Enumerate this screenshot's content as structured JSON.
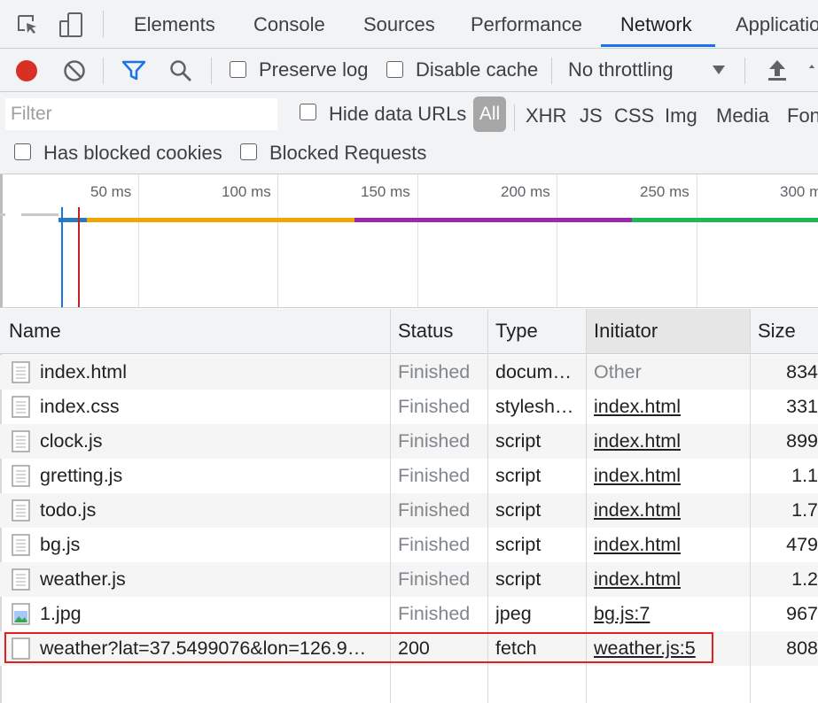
{
  "tabs": [
    {
      "label": "Elements"
    },
    {
      "label": "Console"
    },
    {
      "label": "Sources"
    },
    {
      "label": "Performance"
    },
    {
      "label": "Network",
      "active": true
    },
    {
      "label": "Applicatio"
    }
  ],
  "toolbar": {
    "preserve_log": "Preserve log",
    "disable_cache": "Disable cache",
    "throttling": "No throttling",
    "record_color": "#d93025"
  },
  "filter": {
    "placeholder": "Filter",
    "hide_data_urls": "Hide data URLs",
    "types": [
      "All",
      "XHR",
      "JS",
      "CSS",
      "Img",
      "Media",
      "Fon"
    ],
    "has_blocked_cookies": "Has blocked cookies",
    "blocked_requests": "Blocked Requests"
  },
  "overview": {
    "ticks": [
      "50 ms",
      "100 ms",
      "150 ms",
      "200 ms",
      "250 ms",
      "300 m"
    ],
    "phase_colors": [
      "#f0a500",
      "#9c27b0",
      "#1db954"
    ],
    "dcl_color": "#1a73e8",
    "load_color": "#c5221f"
  },
  "table": {
    "columns": {
      "name": "Name",
      "status": "Status",
      "type": "Type",
      "initiator": "Initiator",
      "size": "Size"
    },
    "rows": [
      {
        "name": "index.html",
        "status": "Finished",
        "type": "docum…",
        "initiator": "Other",
        "size": "834",
        "icon": "document-icon"
      },
      {
        "name": "index.css",
        "status": "Finished",
        "type": "stylesh…",
        "initiator": "index.html",
        "size": "331",
        "icon": "document-icon"
      },
      {
        "name": "clock.js",
        "status": "Finished",
        "type": "script",
        "initiator": "index.html",
        "size": "899",
        "icon": "document-icon"
      },
      {
        "name": "gretting.js",
        "status": "Finished",
        "type": "script",
        "initiator": "index.html",
        "size": "1.1",
        "icon": "document-icon"
      },
      {
        "name": "todo.js",
        "status": "Finished",
        "type": "script",
        "initiator": "index.html",
        "size": "1.7",
        "icon": "document-icon"
      },
      {
        "name": "bg.js",
        "status": "Finished",
        "type": "script",
        "initiator": "index.html",
        "size": "479",
        "icon": "document-icon"
      },
      {
        "name": "weather.js",
        "status": "Finished",
        "type": "script",
        "initiator": "index.html",
        "size": "1.2",
        "icon": "document-icon"
      },
      {
        "name": "1.jpg",
        "status": "Finished",
        "type": "jpeg",
        "initiator": "bg.js:7",
        "size": "967",
        "icon": "image-icon"
      },
      {
        "name": "weather?lat=37.5499076&lon=126.9…",
        "status": "200",
        "type": "fetch",
        "initiator": "weather.js:5",
        "size": "808",
        "icon": "blank-file-icon"
      }
    ]
  }
}
